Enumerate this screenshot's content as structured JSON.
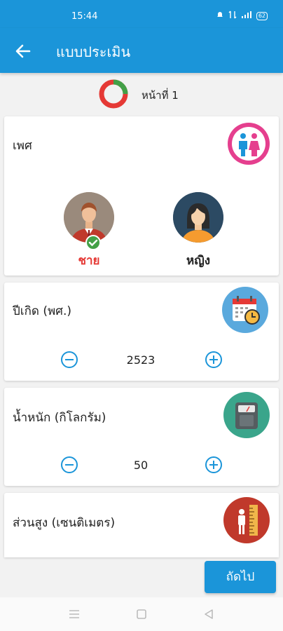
{
  "status_bar": {
    "time": "15:44",
    "battery": "62"
  },
  "app_bar": {
    "title": "แบบประเมิน"
  },
  "page_indicator": {
    "label": "หน้าที่ 1"
  },
  "gender_card": {
    "title": "เพศ",
    "options": [
      {
        "label": "ชาย",
        "selected": true,
        "color": "#e53935"
      },
      {
        "label": "หญิง",
        "selected": false,
        "color": "#222222"
      }
    ]
  },
  "birth_year_card": {
    "title": "ปีเกิด (พศ.)",
    "value": "2523"
  },
  "weight_card": {
    "title": "น้ำหนัก (กิโลกรัม)",
    "value": "50"
  },
  "height_card": {
    "title": "ส่วนสูง (เซนติเมตร)"
  },
  "next_button": {
    "label": "ถัดไป"
  },
  "colors": {
    "primary": "#1b95d9",
    "selected": "#e53935",
    "check": "#43a047"
  }
}
